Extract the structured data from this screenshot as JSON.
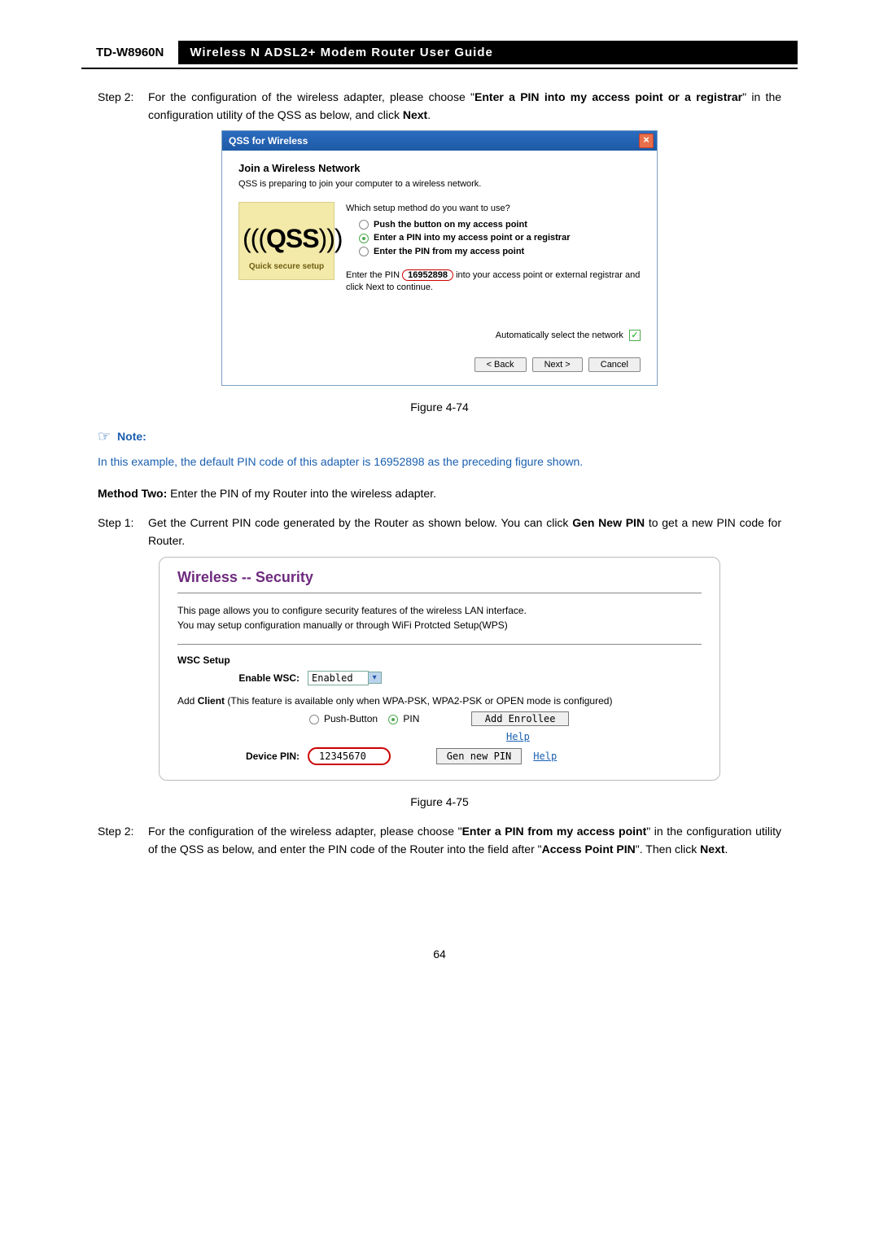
{
  "header": {
    "model": "TD-W8960N",
    "title": "Wireless  N  ADSL2+  Modem  Router  User  Guide"
  },
  "step2a": {
    "label": "Step 2:",
    "text_before": "For the configuration of the wireless adapter, please choose \"",
    "bold1": "Enter a PIN into my access point or a registrar",
    "text_mid": "\" in the configuration utility of the QSS as below, and click ",
    "bold2": "Next",
    "text_after": "."
  },
  "qss": {
    "title": "QSS for Wireless",
    "heading": "Join a Wireless Network",
    "subheading": "QSS is preparing to join your computer to a wireless network.",
    "panel_logo": "QSS",
    "panel_caption": "Quick secure setup",
    "question": "Which setup method do you want to use?",
    "opt1": "Push the button on my access point",
    "opt2": "Enter a PIN into my access point or a registrar",
    "opt3": "Enter the PIN from my access point",
    "pin_pre": "Enter the PIN ",
    "pin_value": "16952898",
    "pin_post": " into your access point or external registrar and click Next to continue.",
    "auto_label": "Automatically select the network",
    "back": "< Back",
    "next": "Next >",
    "cancel": "Cancel"
  },
  "figure1": "Figure 4-74",
  "note": {
    "icon": "☞",
    "label": "Note:",
    "text": "In this example, the default PIN code of this adapter is 16952898 as the preceding figure shown."
  },
  "method2": {
    "bold": "Method Two:",
    "rest": " Enter the PIN of my Router into the wireless adapter."
  },
  "step1b": {
    "label": "Step 1:",
    "pre": "Get the Current PIN code generated by the Router as shown below. You can click ",
    "bold1": "Gen New PIN",
    "mid": " to get a new PIN code for Router."
  },
  "router": {
    "title": "Wireless -- Security",
    "desc1": "This page allows you to configure security features of the wireless LAN interface.",
    "desc2": "You may setup configuration manually or through WiFi Protcted Setup(WPS)",
    "section": "WSC Setup",
    "enable_label": "Enable WSC:",
    "enable_value": "Enabled",
    "addclient_pre": "Add ",
    "addclient_bold": "Client",
    "addclient_post": " (This feature is available only when WPA-PSK, WPA2-PSK or OPEN mode is configured)",
    "radio_push": "Push-Button",
    "radio_pin": "PIN",
    "add_enrollee": "Add Enrollee",
    "help": "Help",
    "devpin_label": "Device PIN:",
    "devpin_value": "12345670",
    "gen_new": "Gen new PIN"
  },
  "figure2": "Figure 4-75",
  "step2b": {
    "label": "Step 2:",
    "pre": "For the configuration of the wireless adapter, please choose \"",
    "bold1": "Enter a PIN from my access point",
    "mid1": "\" in the configuration utility of the QSS as below, and enter the PIN code of the Router into the field after \"",
    "bold2": "Access Point PIN",
    "mid2": "\". Then click ",
    "bold3": "Next",
    "end": "."
  },
  "page_number": "64"
}
